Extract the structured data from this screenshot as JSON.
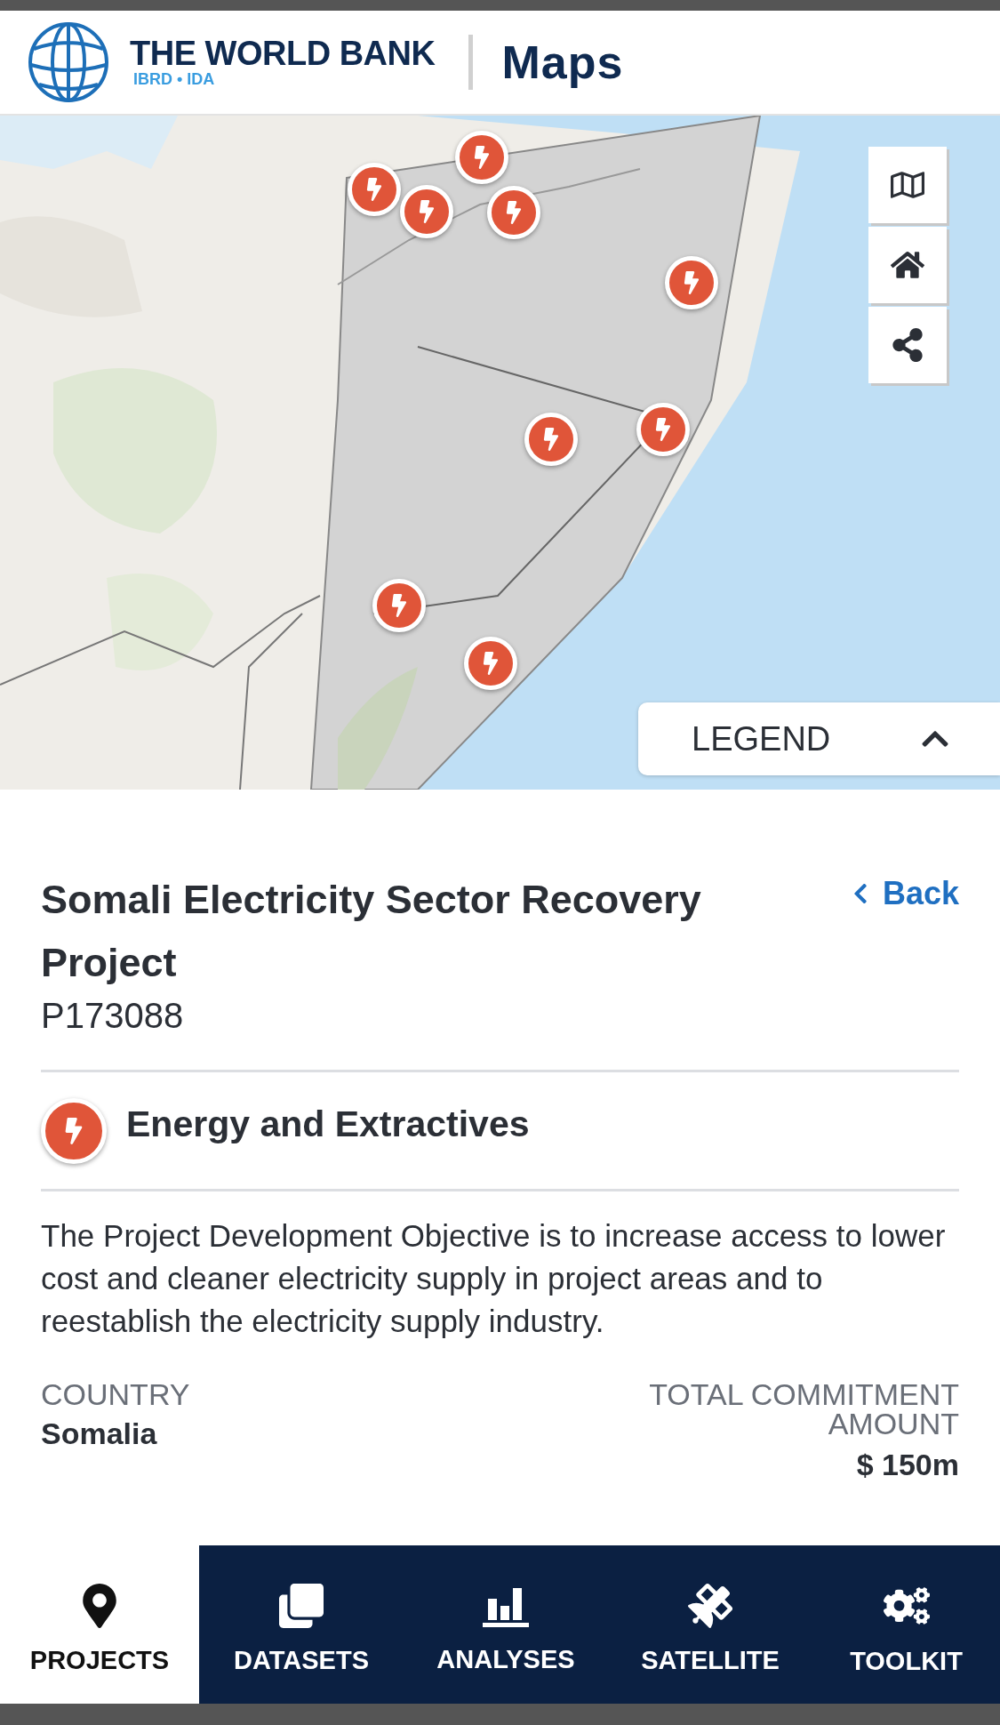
{
  "header": {
    "logo_name": "THE WORLD BANK",
    "logo_tagline": "IBRD • IDA",
    "app_title": "Maps"
  },
  "map": {
    "kind": "picture",
    "controls": [
      {
        "kind": "map"
      },
      {
        "kind": "home"
      },
      {
        "kind": "share"
      }
    ],
    "legend": {
      "label": "LEGEND",
      "expanded": false
    }
  },
  "project": {
    "title": "Somali Electricity Sector Recovery Project",
    "id": "P173088",
    "back": "Back",
    "sector": "Energy and Extractives",
    "description": "The Project Development Objective is to increase access to lower cost and cleaner electricity supply in project areas and to reestablish the electricity supply industry.",
    "fields": [
      {
        "label": "COUNTRY",
        "value": "Somalia"
      },
      {
        "label": "TOTAL COMMITMENT AMOUNT",
        "value": "$ 150m"
      }
    ]
  },
  "nav": [
    {
      "kind": "projects",
      "label": "PROJECTS",
      "selected": true
    },
    {
      "kind": "datasets",
      "label": "DATASETS",
      "selected": false
    },
    {
      "kind": "analyses",
      "label": "ANALYSES",
      "selected": false
    },
    {
      "kind": "satellite",
      "label": "SATELLITE",
      "selected": false
    },
    {
      "kind": "toolkit",
      "label": "TOOLKIT",
      "selected": false
    }
  ]
}
